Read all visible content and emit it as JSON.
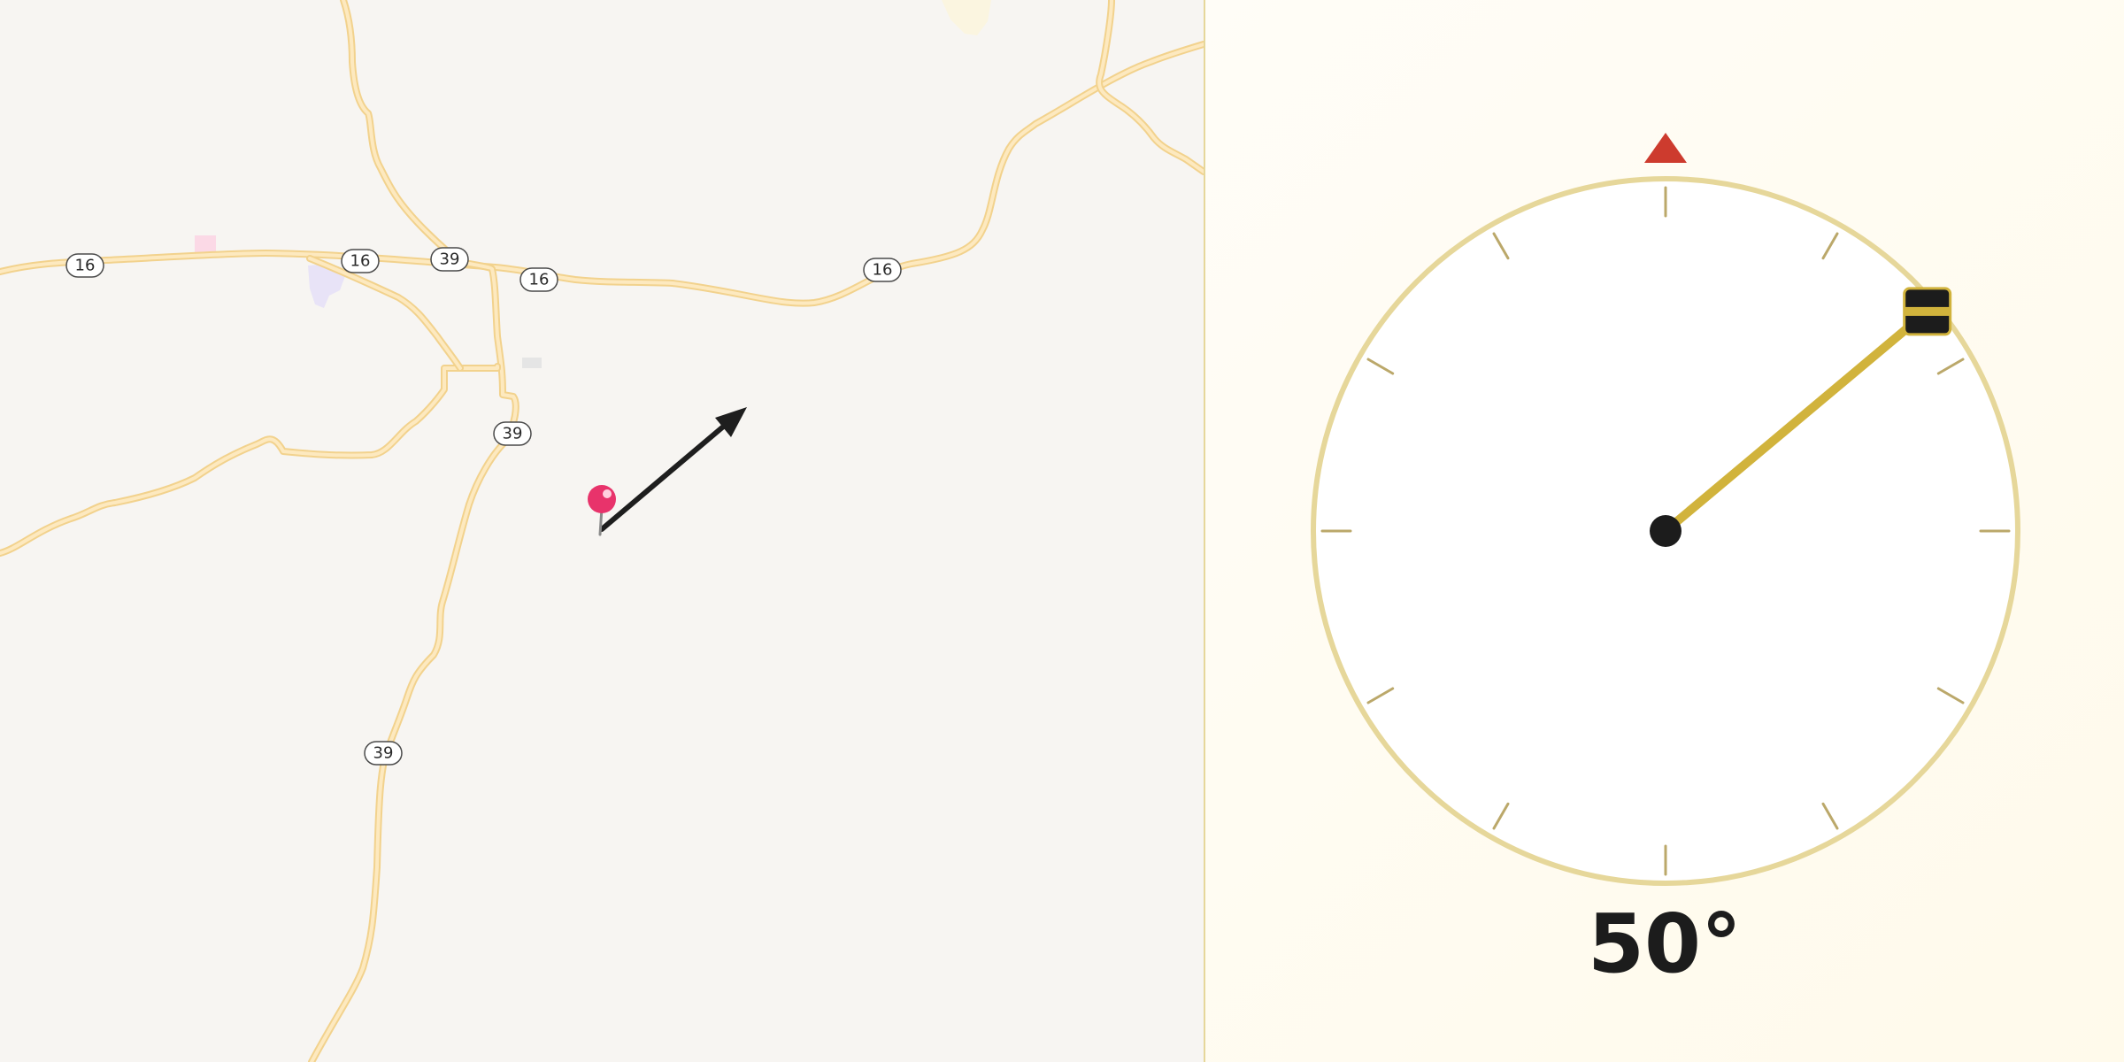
{
  "map": {
    "route_shields": [
      "16",
      "16",
      "39",
      "16",
      "16",
      "39",
      "39"
    ],
    "marker_icon": "map-pin-icon",
    "direction_icon": "direction-arrow-icon",
    "colors": {
      "background": "#f7f5f2",
      "road": "#f2d28d",
      "pin": "#e8336b",
      "arrow": "#1e1e1e"
    }
  },
  "compass": {
    "heading_text": "50°",
    "heading_degrees": 50,
    "north_marker_icon": "north-triangle-icon",
    "handle_icon": "drag-handle-icon",
    "colors": {
      "ring": "#e6d79a",
      "tick": "#bba86a",
      "needle": "#d1b33c",
      "north": "#cd3b2e",
      "hub": "#1c1c1c"
    }
  }
}
